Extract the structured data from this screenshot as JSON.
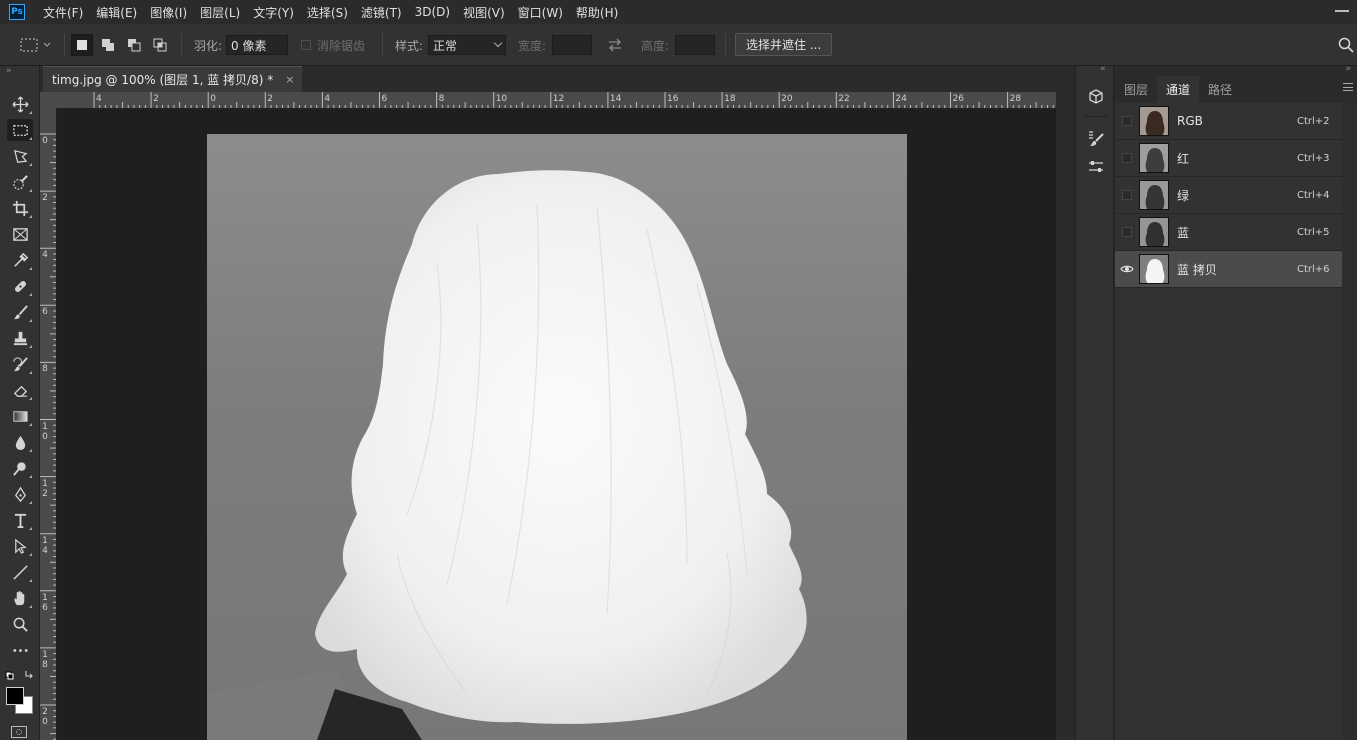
{
  "menu": {
    "logo": "Ps",
    "items": [
      "文件(F)",
      "编辑(E)",
      "图像(I)",
      "图层(L)",
      "文字(Y)",
      "选择(S)",
      "滤镜(T)",
      "3D(D)",
      "视图(V)",
      "窗口(W)",
      "帮助(H)"
    ]
  },
  "options": {
    "feather_label": "羽化:",
    "feather_value": "0 像素",
    "antialias_label": "消除锯齿",
    "style_label": "样式:",
    "style_value": "正常",
    "width_label": "宽度:",
    "height_label": "高度:",
    "select_mask_button": "选择并遮住 ..."
  },
  "document": {
    "tab_title": "timg.jpg @ 100% (图层 1, 蓝 拷贝/8) *",
    "close": "×"
  },
  "ruler_h": [
    "4",
    "2",
    "0",
    "2",
    "4",
    "6",
    "8",
    "10",
    "12",
    "14",
    "16",
    "18",
    "20",
    "22",
    "24",
    "26",
    "28"
  ],
  "ruler_v": [
    "0",
    "2",
    "4",
    "6",
    "8",
    "10",
    "12",
    "14",
    "16",
    "18",
    "20"
  ],
  "panel": {
    "tabs": [
      "图层",
      "通道",
      "路径"
    ],
    "active_tab": "通道",
    "channels": [
      {
        "name": "RGB",
        "shortcut": "Ctrl+2",
        "visible": false,
        "selected": false
      },
      {
        "name": "红",
        "shortcut": "Ctrl+3",
        "visible": false,
        "selected": false
      },
      {
        "name": "绿",
        "shortcut": "Ctrl+4",
        "visible": false,
        "selected": false
      },
      {
        "name": "蓝",
        "shortcut": "Ctrl+5",
        "visible": false,
        "selected": false
      },
      {
        "name": "蓝 拷贝",
        "shortcut": "Ctrl+6",
        "visible": true,
        "selected": true
      }
    ]
  },
  "tools": [
    {
      "name": "move-tool",
      "icon": "move-icon"
    },
    {
      "name": "rect-marquee-tool",
      "icon": "marquee-icon",
      "active": true
    },
    {
      "name": "lasso-tool",
      "icon": "lasso-icon"
    },
    {
      "name": "quick-select-tool",
      "icon": "quick-select-icon"
    },
    {
      "name": "crop-tool",
      "icon": "crop-icon"
    },
    {
      "name": "frame-tool",
      "icon": "frame-icon"
    },
    {
      "name": "eyedropper-tool",
      "icon": "eyedropper-icon"
    },
    {
      "name": "healing-brush-tool",
      "icon": "bandage-icon"
    },
    {
      "name": "brush-tool",
      "icon": "brush-icon"
    },
    {
      "name": "clone-stamp-tool",
      "icon": "stamp-icon"
    },
    {
      "name": "history-brush-tool",
      "icon": "history-brush-icon"
    },
    {
      "name": "eraser-tool",
      "icon": "eraser-icon"
    },
    {
      "name": "gradient-tool",
      "icon": "gradient-icon"
    },
    {
      "name": "blur-tool",
      "icon": "drop-icon"
    },
    {
      "name": "dodge-tool",
      "icon": "dodge-icon"
    },
    {
      "name": "pen-tool",
      "icon": "pen-icon"
    },
    {
      "name": "type-tool",
      "icon": "type-icon"
    },
    {
      "name": "path-select-tool",
      "icon": "arrow-icon"
    },
    {
      "name": "line-tool",
      "icon": "line-icon"
    },
    {
      "name": "hand-tool",
      "icon": "hand-icon"
    },
    {
      "name": "zoom-tool",
      "icon": "zoom-icon"
    },
    {
      "name": "more-tools",
      "icon": "ellipsis-icon"
    }
  ],
  "colors": {
    "foreground": "#000000",
    "background": "#ffffff",
    "accent": "#31a8ff"
  }
}
